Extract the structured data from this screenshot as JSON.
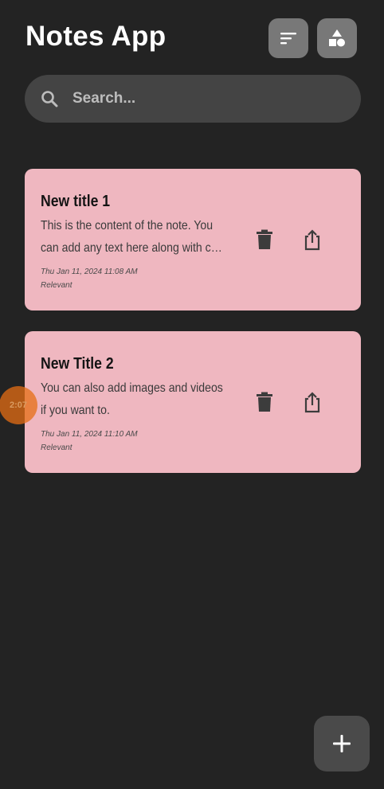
{
  "header": {
    "title": "Notes App",
    "sort_icon": "sort-lines-icon",
    "shapes_icon": "shapes-icon"
  },
  "search": {
    "placeholder": "Search...",
    "value": "",
    "icon": "search-icon"
  },
  "notes": [
    {
      "title": "New title 1",
      "content_line1": "This is the content of the note. You",
      "content_line2": "can add any text here along with ch...",
      "date": "Thu Jan 11, 2024 11:08 AM",
      "tag": "Relevant"
    },
    {
      "title": "New Title 2",
      "content_line1": "You can also add images and videos",
      "content_line2": "if you want to.",
      "date": "Thu Jan 11, 2024 11:10 AM",
      "tag": "Relevant"
    }
  ],
  "fab": {
    "icon": "plus-icon"
  },
  "overlay": {
    "touch_label": "2:07"
  },
  "colors": {
    "background": "#232323",
    "card": "#efb7c0",
    "header_button": "#787878",
    "search_bg": "#444444",
    "fab_bg": "#4a4a4a"
  }
}
